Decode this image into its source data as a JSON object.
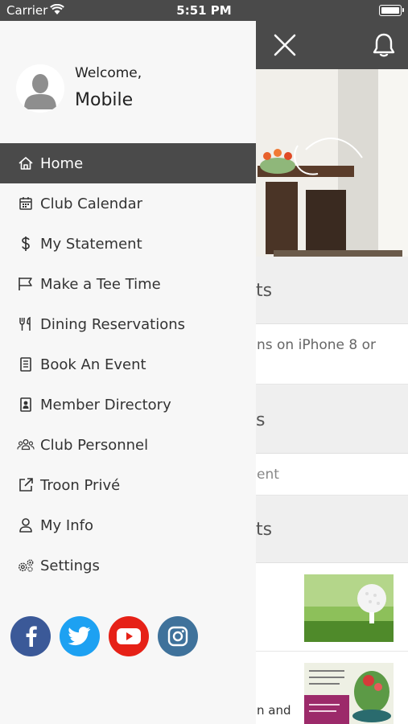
{
  "status_bar": {
    "carrier": "Carrier",
    "time": "5:51 PM"
  },
  "drawer": {
    "welcome": "Welcome,",
    "user_name": "Mobile",
    "items": [
      {
        "label": "Home",
        "icon": "home-icon",
        "active": true
      },
      {
        "label": "Club Calendar",
        "icon": "calendar-icon"
      },
      {
        "label": "My Statement",
        "icon": "dollar-icon"
      },
      {
        "label": "Make a Tee Time",
        "icon": "flag-icon"
      },
      {
        "label": "Dining Reservations",
        "icon": "utensils-icon"
      },
      {
        "label": "Book An Event",
        "icon": "book-icon"
      },
      {
        "label": "Member Directory",
        "icon": "contact-card-icon"
      },
      {
        "label": "Club Personnel",
        "icon": "users-icon"
      },
      {
        "label": "Troon Privé",
        "icon": "external-link-icon"
      },
      {
        "label": "My Info",
        "icon": "user-icon"
      },
      {
        "label": "Settings",
        "icon": "gears-icon"
      }
    ],
    "social": [
      {
        "name": "facebook-icon",
        "color": "#3b5998"
      },
      {
        "name": "twitter-icon",
        "color": "#1da1f2"
      },
      {
        "name": "youtube-icon",
        "color": "#e62117"
      },
      {
        "name": "instagram-icon",
        "color": "#3f729b"
      }
    ]
  },
  "background": {
    "sections": [
      {
        "title_fragment": "ts",
        "row_text": "ns on iPhone 8 or"
      },
      {
        "title_fragment": "s",
        "row_text": "ent"
      },
      {
        "title_fragment": "ts"
      }
    ],
    "news_text": "n and"
  },
  "colors": {
    "topbar": "#4a4a4a",
    "drawer": "#f7f7f7",
    "active_item": "#4a4a4a"
  }
}
